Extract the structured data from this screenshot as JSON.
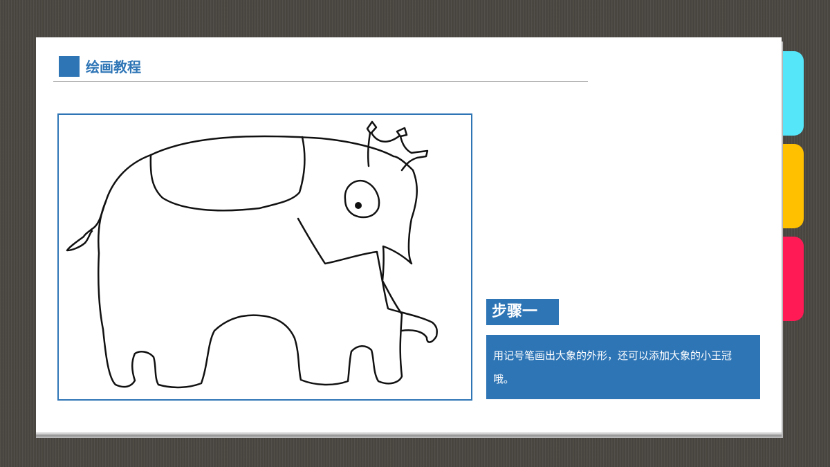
{
  "slide": {
    "title": "绘画教程",
    "step_label": "步骤一",
    "description": "用记号笔画出大象的外形，还可以添加大象的小王冠哦。"
  },
  "side_tabs": [
    {
      "color": "#55e6fa"
    },
    {
      "color": "#ffc000"
    },
    {
      "color": "#ff1a55"
    }
  ],
  "colors": {
    "accent": "#2e75b6",
    "background": "#4a4640"
  }
}
